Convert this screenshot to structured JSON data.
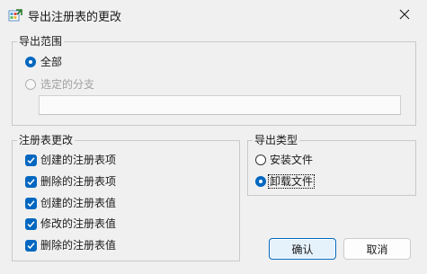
{
  "window": {
    "title": "导出注册表的更改",
    "icon": "registry-export-icon"
  },
  "export_range": {
    "label": "导出范围",
    "all_label": "全部",
    "branch_label": "选定的分支",
    "branch_value": ""
  },
  "registry_changes": {
    "label": "注册表更改",
    "items": [
      {
        "label": "创建的注册表项",
        "checked": true
      },
      {
        "label": "删除的注册表项",
        "checked": true
      },
      {
        "label": "创建的注册表值",
        "checked": true
      },
      {
        "label": "修改的注册表值",
        "checked": true
      },
      {
        "label": "删除的注册表值",
        "checked": true
      }
    ]
  },
  "export_type": {
    "label": "导出类型",
    "install_label": "安装文件",
    "uninstall_label": "卸载文件",
    "selected": "uninstall"
  },
  "buttons": {
    "ok": "确认",
    "cancel": "取消"
  },
  "colors": {
    "accent": "#0067c0",
    "background": "#f0f0f0"
  }
}
